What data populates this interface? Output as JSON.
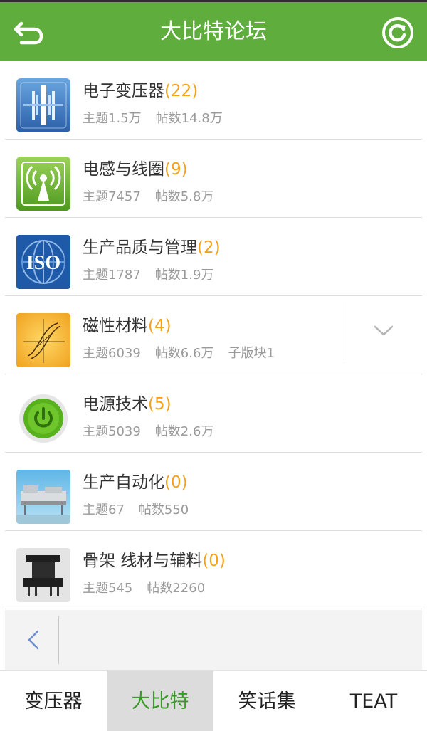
{
  "header": {
    "title": "大比特论坛"
  },
  "forums": [
    {
      "name": "电子变压器",
      "count": "(22)",
      "topics": "主题1.5万",
      "posts": "帖数14.8万",
      "sub": "",
      "icon": "transformer-icon"
    },
    {
      "name": "电感与线圈",
      "count": "(9)",
      "topics": "主题7457",
      "posts": "帖数5.8万",
      "sub": "",
      "icon": "antenna-icon"
    },
    {
      "name": "生产品质与管理",
      "count": "(2)",
      "topics": "主题1787",
      "posts": "帖数1.9万",
      "sub": "",
      "icon": "iso-globe-icon"
    },
    {
      "name": "磁性材料",
      "count": "(4)",
      "topics": "主题6039",
      "posts": "帖数6.6万",
      "sub": "子版块1",
      "icon": "magnetic-curve-icon"
    },
    {
      "name": "电源技术",
      "count": "(5)",
      "topics": "主题5039",
      "posts": "帖数2.6万",
      "sub": "",
      "icon": "power-button-icon"
    },
    {
      "name": "生产自动化",
      "count": "(0)",
      "topics": "主题67",
      "posts": "帖数550",
      "sub": "",
      "icon": "automation-machine-icon"
    },
    {
      "name": "骨架 线材与辅料",
      "count": "(0)",
      "topics": "主题545",
      "posts": "帖数2260",
      "sub": "",
      "icon": "coil-bobbin-icon"
    }
  ],
  "tabs": [
    {
      "label": "变压器",
      "active": false
    },
    {
      "label": "大比特",
      "active": true
    },
    {
      "label": "笑话集",
      "active": false
    },
    {
      "label": "TEAT",
      "active": false
    }
  ],
  "colors": {
    "header_bg": "#5fae3d",
    "count_orange": "#f3a21a",
    "active_tab_text": "#3a9a28"
  }
}
